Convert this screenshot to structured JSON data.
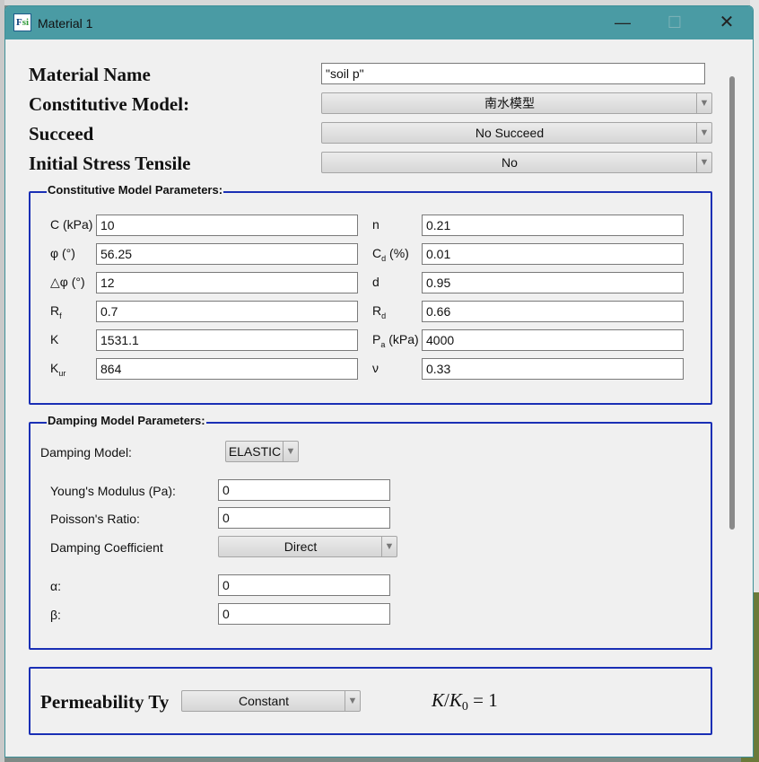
{
  "window": {
    "title": "Material 1",
    "icon": "fesi-app-icon",
    "min_glyph": "—",
    "max_glyph": "☐",
    "close_glyph": "✕"
  },
  "general": {
    "material_name_label": "Material Name",
    "material_name_value": "\"soil p\"",
    "constitutive_model_label": "Constitutive Model:",
    "constitutive_model_value": "南水模型",
    "succeed_label": "Succeed",
    "succeed_value": "No Succeed",
    "initial_stress_label": "Initial Stress Tensile",
    "initial_stress_value": "No"
  },
  "constitutive": {
    "title": "Constitutive Model Parameters:",
    "left": [
      {
        "label": "C (kPa)",
        "value": "10"
      },
      {
        "label": "φ (°)",
        "value": "56.25"
      },
      {
        "label": "△φ (°)",
        "value": "12"
      },
      {
        "label_main": "R",
        "label_sub": "f",
        "value": "0.7"
      },
      {
        "label": "K",
        "value": "1531.1"
      },
      {
        "label_main": "K",
        "label_sub": "ur",
        "value": "864"
      }
    ],
    "right": [
      {
        "label": "n",
        "value": "0.21"
      },
      {
        "label_main": "C",
        "label_sub": "d",
        "label_tail": " (%)",
        "value": "0.01"
      },
      {
        "label": "d",
        "value": "0.95"
      },
      {
        "label_main": "R",
        "label_sub": "d",
        "value": "0.66"
      },
      {
        "label_main": "P",
        "label_sub": "a",
        "label_tail": " (kPa)",
        "value": "4000"
      },
      {
        "label": "ν",
        "value": "0.33"
      }
    ]
  },
  "damping": {
    "title": "Damping Model Parameters:",
    "model_label": "Damping Model:",
    "model_value": "ELASTIC",
    "youngs_label": "Young's Modulus (Pa):",
    "youngs_value": "0",
    "poisson_label": "Poisson's Ratio:",
    "poisson_value": "0",
    "coef_label": "Damping Coefficient",
    "coef_value": "Direct",
    "alpha_label": "α:",
    "alpha_value": "0",
    "beta_label": "β:",
    "beta_value": "0"
  },
  "permeability": {
    "label": "Permeability Ty",
    "value": "Constant",
    "formula_k": "K",
    "formula_slash": "/",
    "formula_k0": "K",
    "formula_k0_sub": "0",
    "formula_eq": " = 1"
  },
  "icons": {
    "dropdown": "▼"
  },
  "colors": {
    "titlebar": "#4a9ba4",
    "group_border": "#1a2fb5"
  }
}
